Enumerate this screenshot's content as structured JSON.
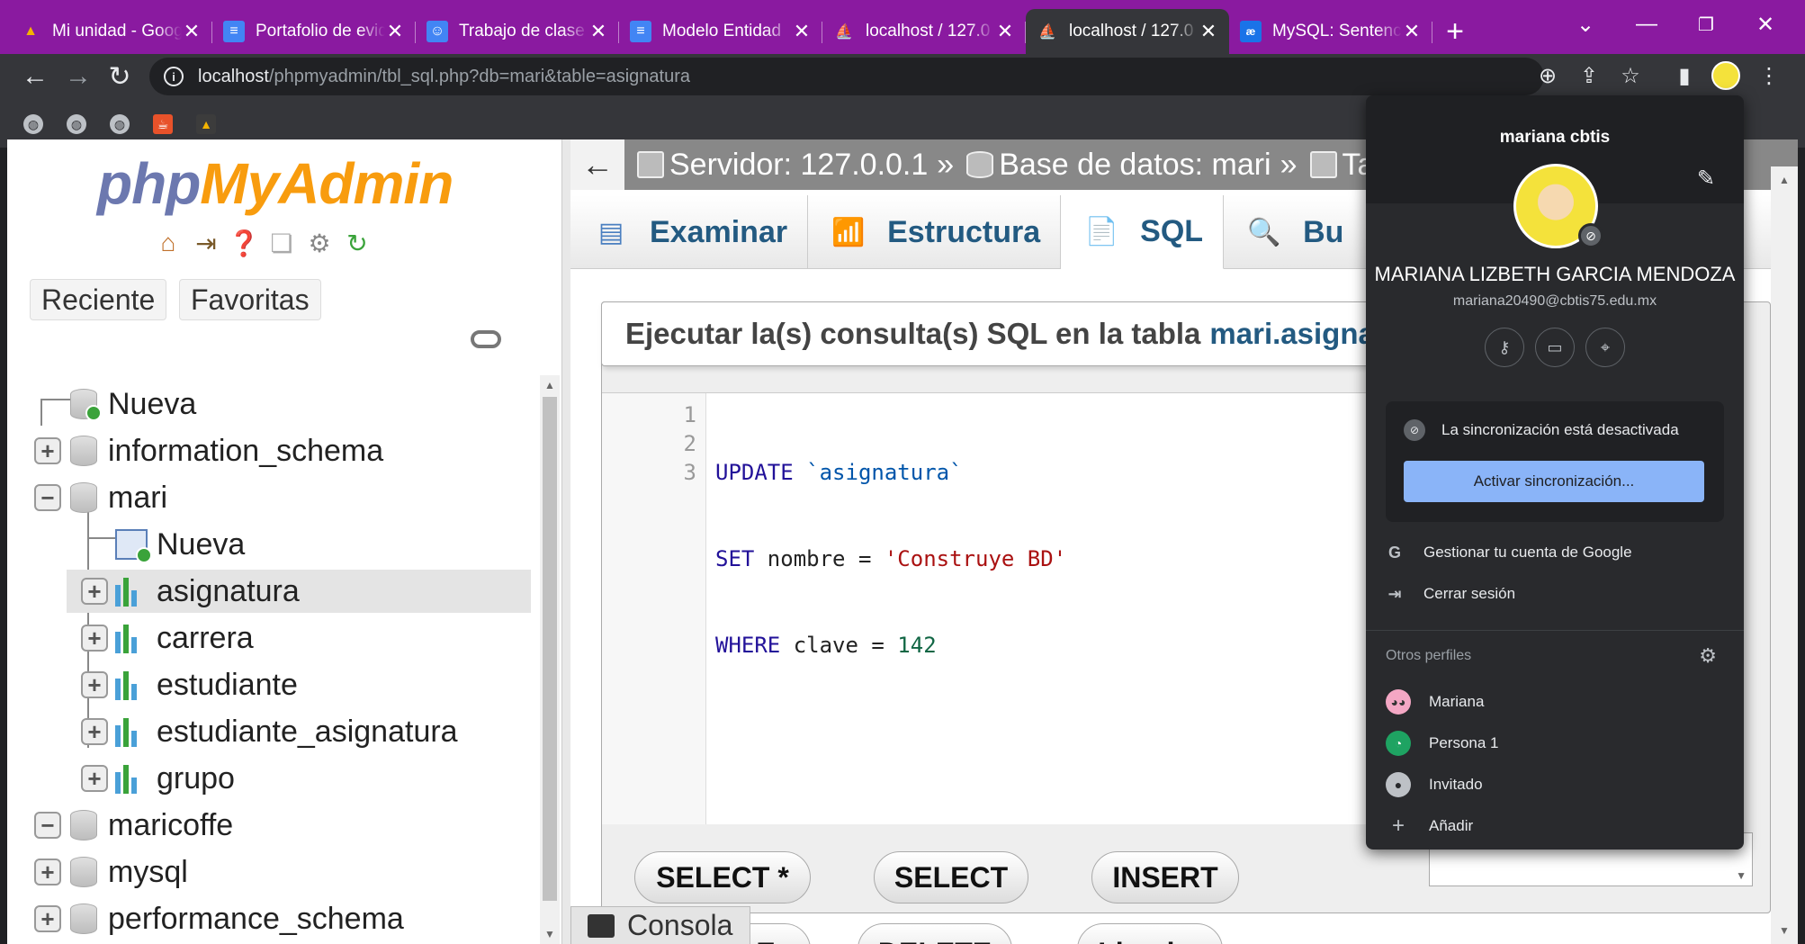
{
  "browser": {
    "tabs": [
      {
        "title": "Mi unidad - Goog",
        "icon": "drive-icon",
        "color": "#f4b400"
      },
      {
        "title": "Portafolio de evid",
        "icon": "docs-icon",
        "color": "#4285f4"
      },
      {
        "title": "Trabajo de clase",
        "icon": "classroom-icon",
        "color": "#4285f4"
      },
      {
        "title": "Modelo Entidad",
        "icon": "docs-icon",
        "color": "#4285f4"
      },
      {
        "title": "localhost / 127.0",
        "icon": "phpmyadmin-icon",
        "color": "#f89c0e"
      },
      {
        "title": "localhost / 127.0",
        "icon": "phpmyadmin-icon",
        "color": "#f89c0e"
      },
      {
        "title": "MySQL: Sentencia",
        "icon": "mysql-icon",
        "color": "#1a73e8"
      }
    ],
    "active_tab": 5,
    "url_host": "localhost",
    "url_path": "/phpmyadmin/tbl_sql.php?db=mari&table=asignatura"
  },
  "pma": {
    "logo_php": "php",
    "logo_myadmin": "MyAdmin",
    "recent_label": "Reciente",
    "favorites_label": "Favoritas",
    "tree": {
      "new_root": "Nueva",
      "info_schema": "information_schema",
      "mari": "mari",
      "new_table": "Nueva",
      "asignatura": "asignatura",
      "carrera": "carrera",
      "estudiante": "estudiante",
      "estudiante_asignatura": "estudiante_asignatura",
      "grupo": "grupo",
      "maricoffe": "maricoffe",
      "mysql": "mysql",
      "performance_schema": "performance_schema"
    },
    "breadcrumb": {
      "server": "Servidor: 127.0.0.1",
      "sep": "»",
      "database": "Base de datos: mari",
      "table": "Ta"
    },
    "tabs": {
      "browse": "Examinar",
      "structure": "Estructura",
      "sql": "SQL",
      "search": "Bu"
    },
    "query_title": "Ejecutar la(s) consulta(s) SQL en la tabla",
    "query_table": "mari.asigna",
    "code_lines": [
      "1",
      "2",
      "3"
    ],
    "code": {
      "l1_kw": "UPDATE",
      "l1_ident": "`asignatura`",
      "l2_kw": "SET",
      "l2_rest": " nombre = ",
      "l2_str": "'Construye BD'",
      "l3_kw": "WHERE",
      "l3_rest": " clave = ",
      "l3_num": "142"
    },
    "buttons": {
      "select_star": "SELECT *",
      "select": "SELECT",
      "insert": "INSERT",
      "update_partial": "E",
      "delete": "DELETE",
      "clear": "Limpiar"
    },
    "console_label": "Consola"
  },
  "profile": {
    "account_name": "mariana cbtis",
    "full_name": "MARIANA LIZBETH GARCIA MENDOZA",
    "email": "mariana20490@cbtis75.edu.mx",
    "sync_status": "La sincronización está desactivada",
    "sync_button": "Activar sincronización...",
    "manage_account": "Gestionar tu cuenta de Google",
    "sign_out": "Cerrar sesión",
    "other_profiles": "Otros perfiles",
    "profiles": [
      "Mariana",
      "Persona 1",
      "Invitado"
    ],
    "add": "Añadir"
  }
}
